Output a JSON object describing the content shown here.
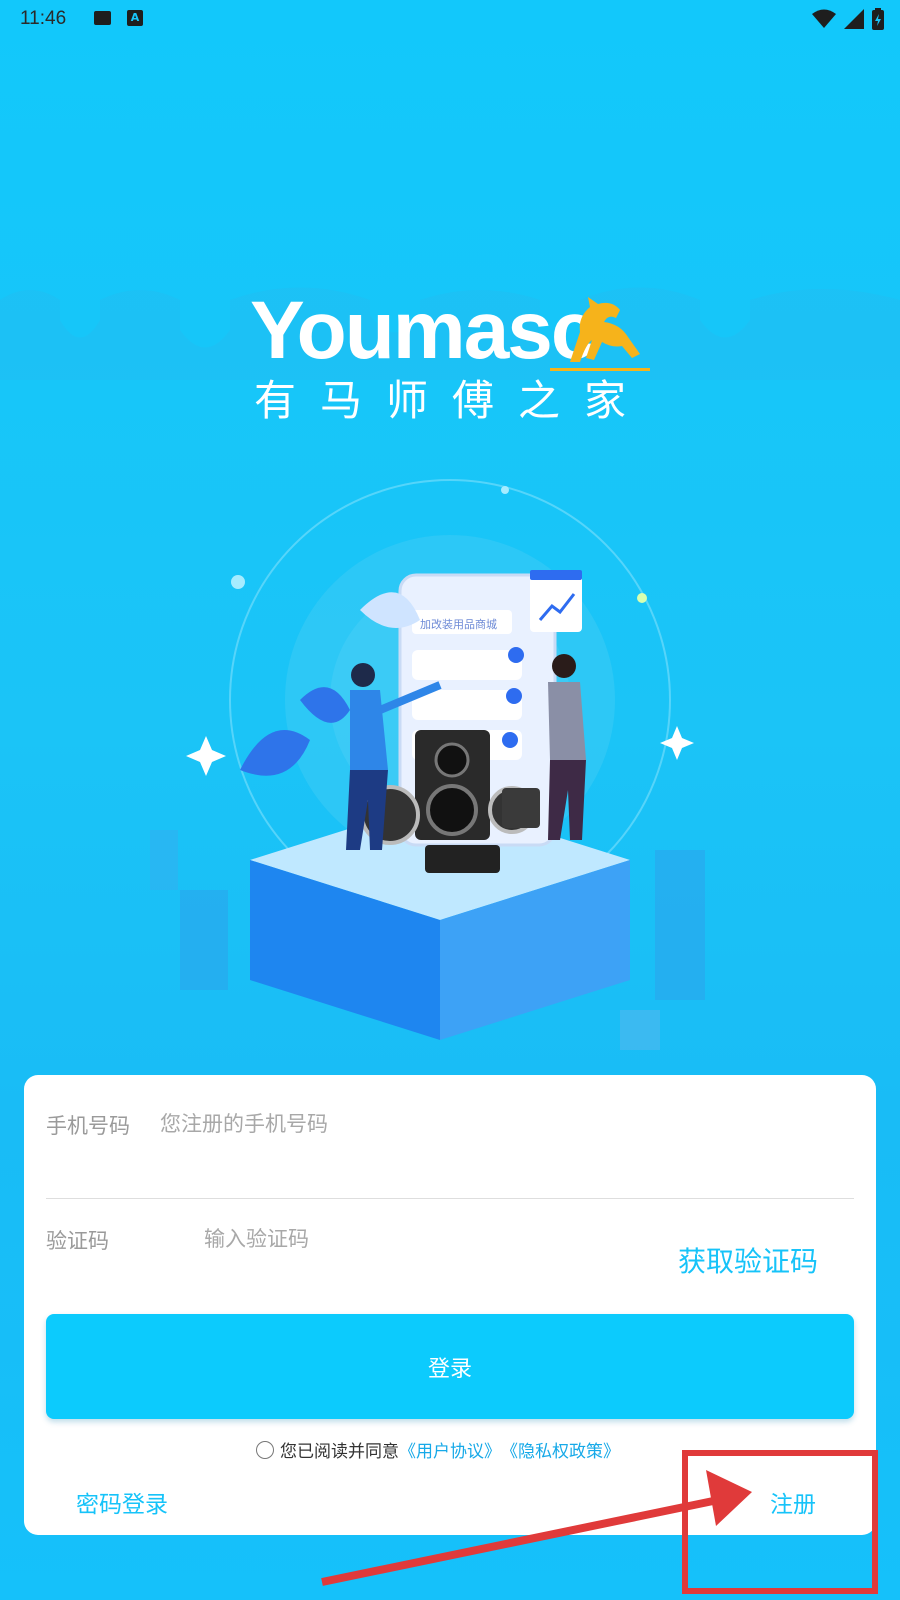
{
  "status_bar": {
    "time": "11:46",
    "icons": [
      "image-icon",
      "a-notification-icon",
      "wifi-icon",
      "signal-icon",
      "battery-icon"
    ]
  },
  "brand": {
    "name": "Youmasc",
    "subtitle": "有马师傅之家"
  },
  "illustration": {
    "phone_card_text": "加改装用品商城"
  },
  "login_form": {
    "phone_label": "手机号码",
    "phone_placeholder": "您注册的手机号码",
    "code_label": "验证码",
    "code_placeholder": "输入验证码",
    "get_code_label": "获取验证码",
    "login_button": "登录",
    "agree_prefix": "您已阅读并同意",
    "user_agreement": "《用户协议》",
    "privacy_policy": "《隐私权政策》",
    "password_login": "密码登录",
    "register": "注册"
  },
  "colors": {
    "background": "#15c3fa",
    "accent": "#0ccbfd",
    "link": "#16c3f9",
    "annotation": "#e03a3a"
  }
}
